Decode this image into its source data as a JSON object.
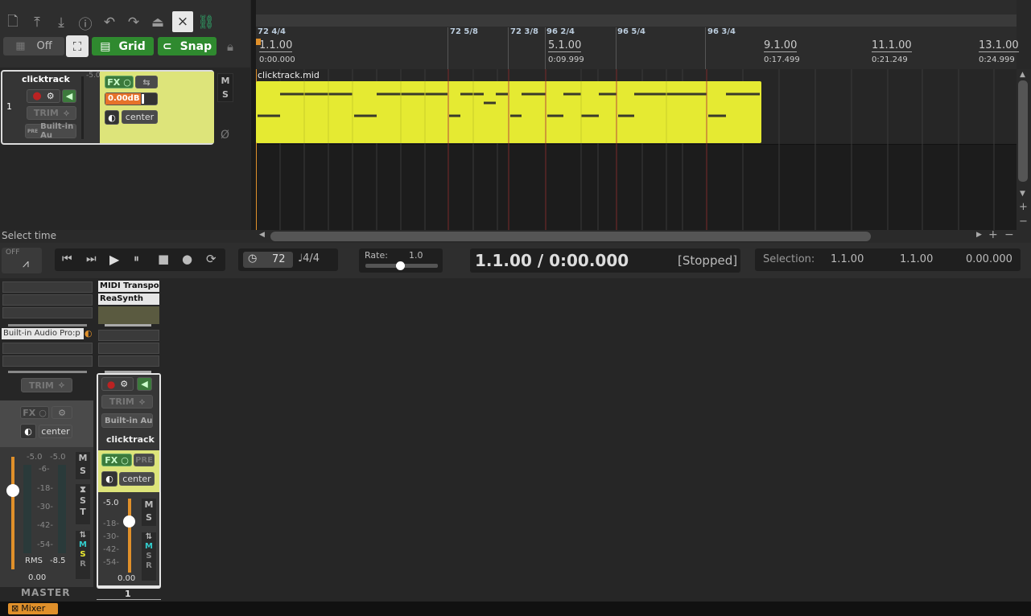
{
  "toolbar": {
    "icons": [
      "new-file-icon",
      "upload-icon",
      "download-icon",
      "info-icon",
      "undo-icon",
      "redo-icon",
      "metronome-icon",
      "crossfade-icon",
      "link-icon"
    ],
    "autoxfade_label": "Off",
    "grid_label": "Grid",
    "snap_label": "Snap"
  },
  "track": {
    "name": "clicktrack",
    "number": "1",
    "peak": "-5.0",
    "trim_label": "TRIM",
    "input_label": "Built-in Au",
    "pre_label": "PRE",
    "fx_label": "FX",
    "volume_value": "0.00dB",
    "pan_value": "center",
    "mute_label": "M",
    "solo_label": "S",
    "phase_glyph": "Ø"
  },
  "ruler": {
    "markers": [
      {
        "text": "72 4/4"
      },
      {
        "text": "72 5/8"
      },
      {
        "text": "72 3/8"
      },
      {
        "text": "96 2/4"
      },
      {
        "text": "96 5/4"
      },
      {
        "text": "96 3/4"
      }
    ],
    "bars": [
      {
        "bar": "1.1.00",
        "time": "0:00.000"
      },
      {
        "bar": "5.1.00",
        "time": "0:09.999"
      },
      {
        "bar": "9.1.00",
        "time": "0:17.499"
      },
      {
        "bar": "11.1.00",
        "time": "0:21.249"
      },
      {
        "bar": "13.1.00",
        "time": "0:24.999"
      }
    ]
  },
  "item": {
    "name": "clicktrack.mid",
    "color": "#e5ea32"
  },
  "status": {
    "text": "Select time"
  },
  "transport": {
    "off_label": "OFF",
    "tempo": "72",
    "timesig": "4/4",
    "rate_label": "Rate:",
    "rate_value": "1.0",
    "position": "1.1.00 / 0:00.000",
    "state": "[Stopped]",
    "selection_label": "Selection:",
    "sel_start": "1.1.00",
    "sel_end": "1.1.00",
    "sel_length": "0.00.000"
  },
  "mixer": {
    "master": {
      "input_label": "Built-in Audio Pro:p",
      "trim_label": "TRIM",
      "fx_label": "FX",
      "pan_value": "center",
      "peak_left": "-5.0",
      "peak_right": "-5.0",
      "rms_label": "RMS",
      "rms_value": "-8.5",
      "volume": "0.00",
      "name": "MASTER",
      "scale": [
        "-6-",
        "-18-",
        "-30-",
        "-42-",
        "-54-"
      ]
    },
    "track1": {
      "fx_chain": [
        "MIDI Transpo",
        "ReaSynth"
      ],
      "trim_label": "TRIM",
      "input_label": "Built-in Auc",
      "name": "clicktrack",
      "fx_label": "FX",
      "pre_label": "PRE",
      "pan_value": "center",
      "peak": "-5.0",
      "scale": [
        "-18-",
        "-30-",
        "-42-",
        "-54-"
      ],
      "volume": "0.00",
      "number": "1"
    }
  },
  "docker": {
    "tab_label": "Mixer"
  },
  "colors": {
    "accent_green": "#2f8a2f",
    "item_yellow": "#e5ea32",
    "fader_orange": "#e0902a"
  }
}
